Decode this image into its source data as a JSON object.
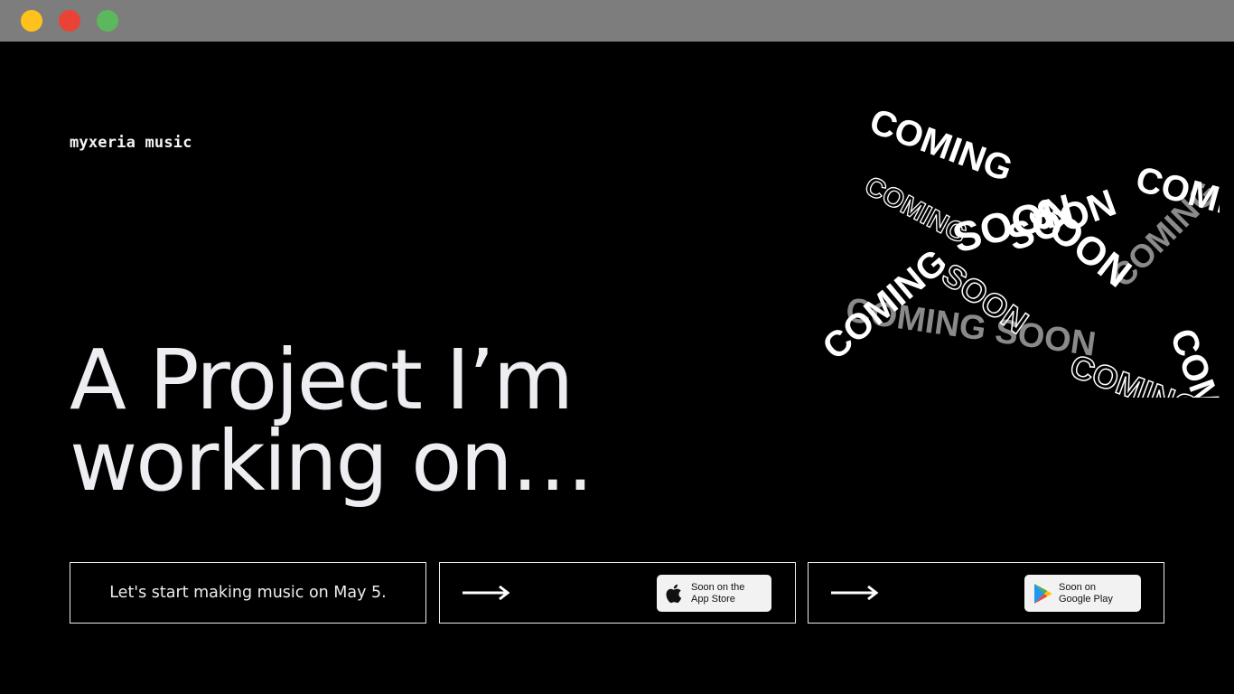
{
  "window": {
    "controls": [
      "minimize",
      "close",
      "maximize"
    ],
    "colors": {
      "minimize": "#ffc21c",
      "close": "#eb4236",
      "maximize": "#5cb85c",
      "titlebar": "#7d7d7d"
    }
  },
  "brand": {
    "name": "myxeria music"
  },
  "headline": {
    "line1": "A Project I’m",
    "line2": "working on…"
  },
  "cards": {
    "announcement": "Let's start making music on May 5.",
    "app_store": {
      "line1": "Soon on the",
      "line2": "App Store",
      "icon": "apple-icon"
    },
    "google_play": {
      "line1": "Soon on",
      "line2": "Google Play",
      "icon": "google-play-icon"
    }
  },
  "artwork": {
    "word1": "COMING",
    "word2": "SOON",
    "colors": {
      "primary": "#ffffff",
      "secondary": "#8a8a8a",
      "outline": "#ffffff"
    }
  }
}
